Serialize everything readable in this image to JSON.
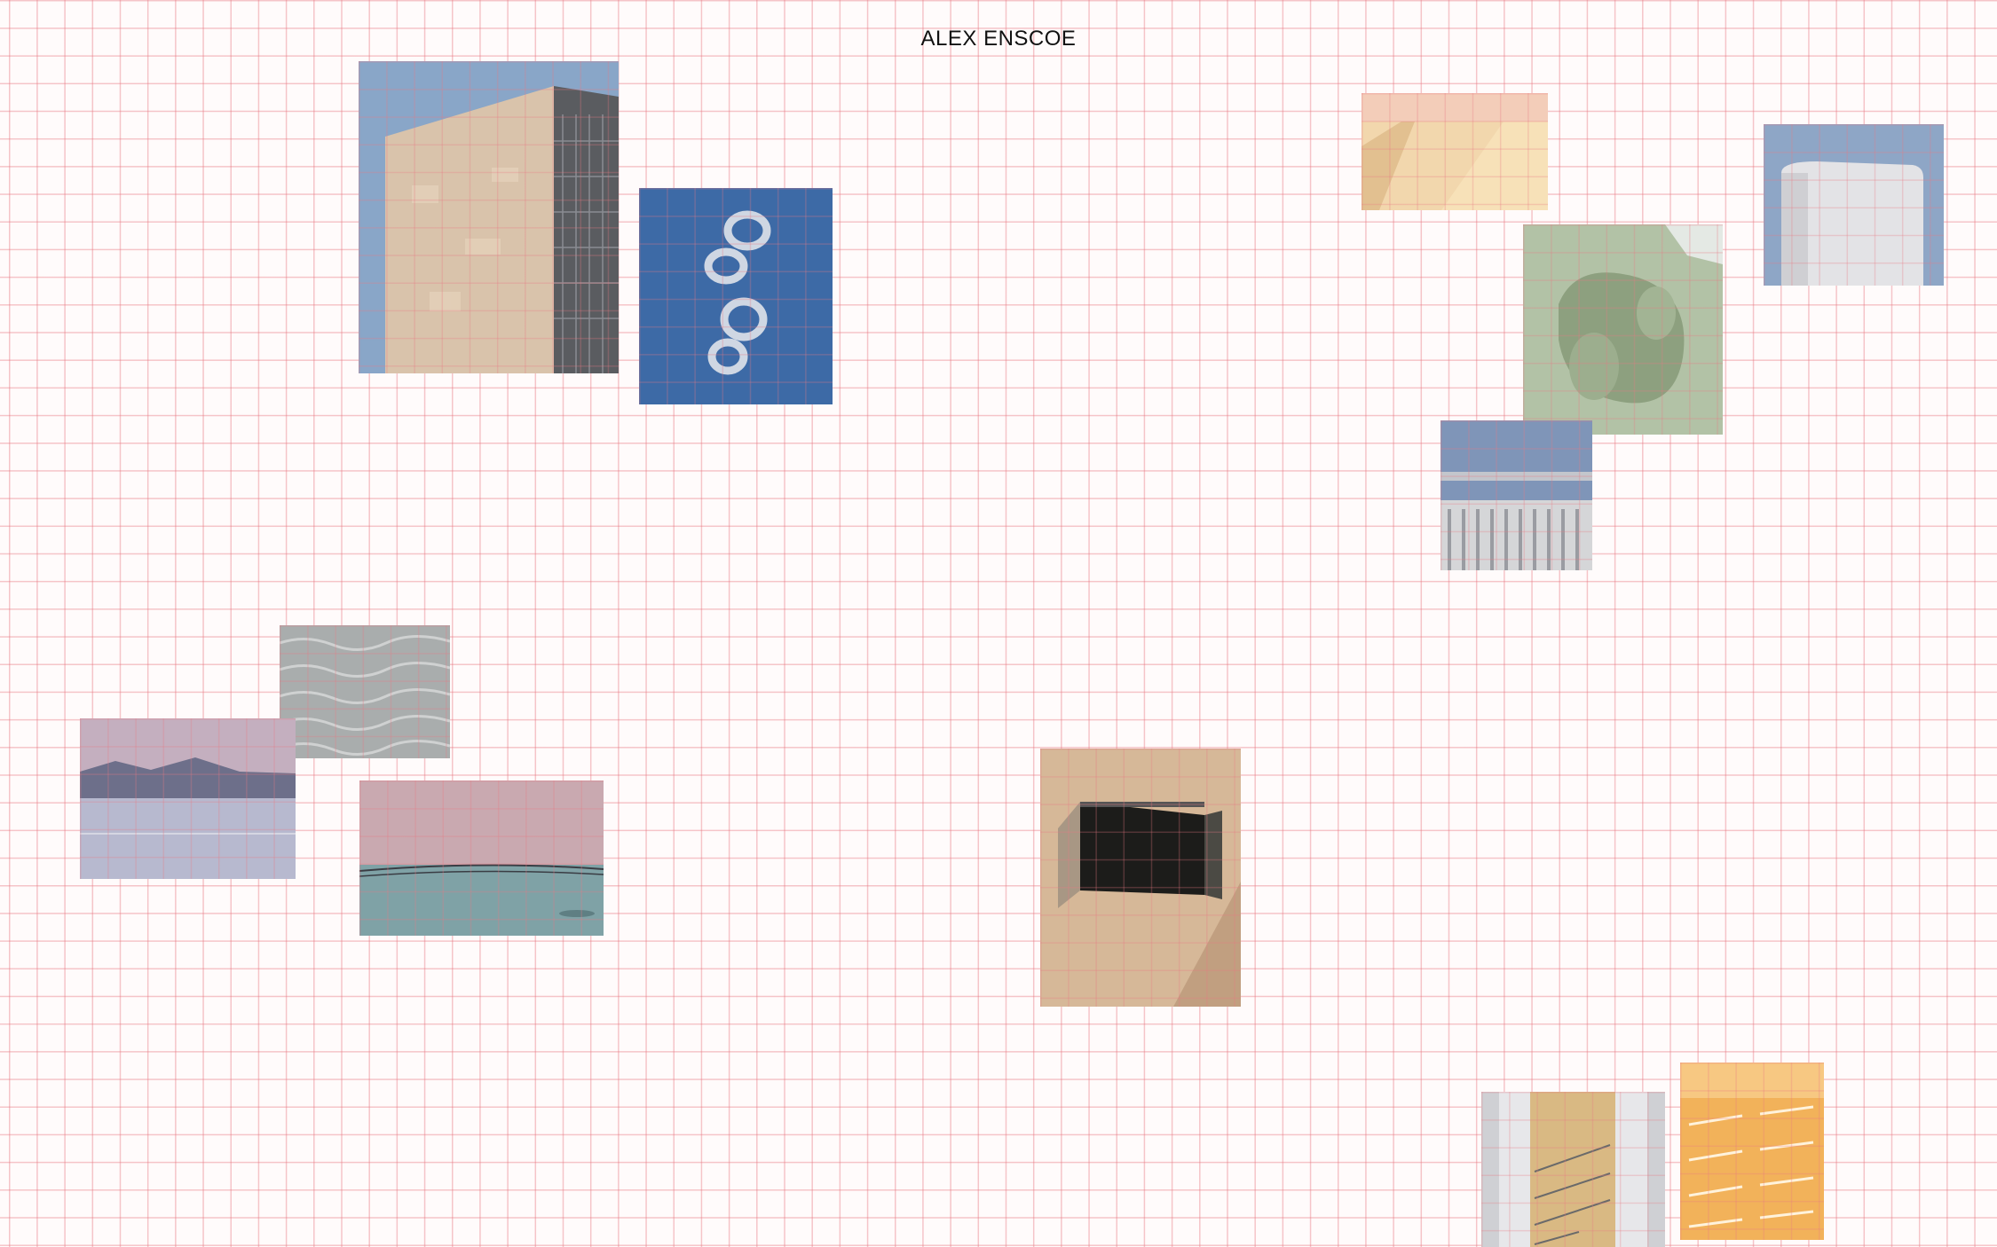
{
  "site": {
    "title": "ALEX ENSCOE"
  },
  "gallery": {
    "photos": [
      {
        "name": "photo-stone-tower",
        "subject": "tower"
      },
      {
        "name": "photo-smoke-rings",
        "subject": "sky"
      },
      {
        "name": "photo-yellow-facade",
        "subject": "facade"
      },
      {
        "name": "photo-round-building",
        "subject": "building"
      },
      {
        "name": "photo-green-sculpture",
        "subject": "sculpture"
      },
      {
        "name": "photo-railing",
        "subject": "railing"
      },
      {
        "name": "photo-water-ripples",
        "subject": "water"
      },
      {
        "name": "photo-mountain-lake",
        "subject": "lake"
      },
      {
        "name": "photo-sea-horizon",
        "subject": "sea"
      },
      {
        "name": "photo-window-shadow",
        "subject": "window"
      },
      {
        "name": "photo-stairwell",
        "subject": "stairs"
      },
      {
        "name": "photo-orange-ceiling",
        "subject": "ceiling"
      }
    ]
  },
  "colors": {
    "grid_line": "#e87882",
    "background": "#fffbfb",
    "title_text": "#111111"
  }
}
